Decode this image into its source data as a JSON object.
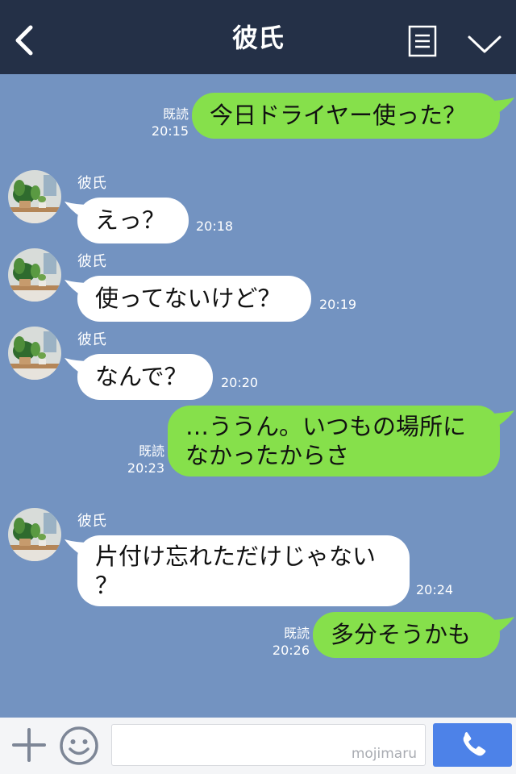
{
  "header": {
    "title": "彼氏"
  },
  "contact": {
    "name": "彼氏"
  },
  "messages": [
    {
      "from": "me",
      "text": "今日ドライヤー使った？",
      "read": "既読",
      "time": "20:15"
    },
    {
      "from": "them",
      "text": "えっ？",
      "time": "20:18"
    },
    {
      "from": "them",
      "text": "使ってないけど？",
      "time": "20:19"
    },
    {
      "from": "them",
      "text": "なんで？",
      "time": "20:20"
    },
    {
      "from": "me",
      "lines": [
        "…ううん。いつもの場所に",
        "なかったからさ"
      ],
      "read": "既読",
      "time": "20:23"
    },
    {
      "from": "them",
      "lines": [
        "片付け忘れただけじゃない",
        "？"
      ],
      "time": "20:24"
    },
    {
      "from": "me",
      "text": "多分そうかも",
      "read": "既読",
      "time": "20:26"
    }
  ],
  "footer": {
    "input_value": "",
    "watermark": "mojimaru"
  },
  "colors": {
    "header": "#243047",
    "chat_bg": "#7393c1",
    "my_bubble": "#86e04b",
    "their_bubble": "#ffffff",
    "call_button": "#4d82e8"
  },
  "icons": [
    "back-icon",
    "menu-icon",
    "chevron-down-icon",
    "plus-icon",
    "smile-icon",
    "phone-icon"
  ]
}
